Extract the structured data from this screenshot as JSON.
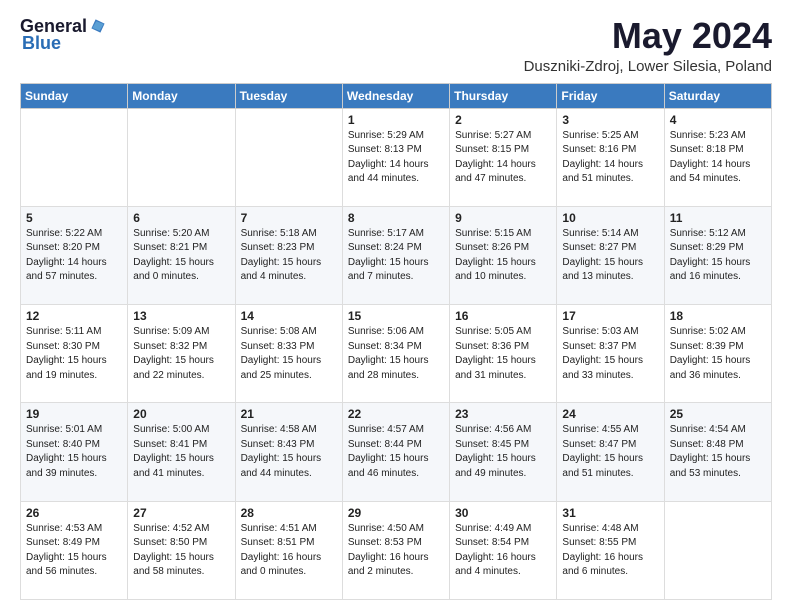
{
  "header": {
    "logo_general": "General",
    "logo_blue": "Blue",
    "month": "May 2024",
    "location": "Duszniki-Zdroj, Lower Silesia, Poland"
  },
  "columns": [
    "Sunday",
    "Monday",
    "Tuesday",
    "Wednesday",
    "Thursday",
    "Friday",
    "Saturday"
  ],
  "weeks": [
    [
      {
        "day": "",
        "info": ""
      },
      {
        "day": "",
        "info": ""
      },
      {
        "day": "",
        "info": ""
      },
      {
        "day": "1",
        "info": "Sunrise: 5:29 AM\nSunset: 8:13 PM\nDaylight: 14 hours\nand 44 minutes."
      },
      {
        "day": "2",
        "info": "Sunrise: 5:27 AM\nSunset: 8:15 PM\nDaylight: 14 hours\nand 47 minutes."
      },
      {
        "day": "3",
        "info": "Sunrise: 5:25 AM\nSunset: 8:16 PM\nDaylight: 14 hours\nand 51 minutes."
      },
      {
        "day": "4",
        "info": "Sunrise: 5:23 AM\nSunset: 8:18 PM\nDaylight: 14 hours\nand 54 minutes."
      }
    ],
    [
      {
        "day": "5",
        "info": "Sunrise: 5:22 AM\nSunset: 8:20 PM\nDaylight: 14 hours\nand 57 minutes."
      },
      {
        "day": "6",
        "info": "Sunrise: 5:20 AM\nSunset: 8:21 PM\nDaylight: 15 hours\nand 0 minutes."
      },
      {
        "day": "7",
        "info": "Sunrise: 5:18 AM\nSunset: 8:23 PM\nDaylight: 15 hours\nand 4 minutes."
      },
      {
        "day": "8",
        "info": "Sunrise: 5:17 AM\nSunset: 8:24 PM\nDaylight: 15 hours\nand 7 minutes."
      },
      {
        "day": "9",
        "info": "Sunrise: 5:15 AM\nSunset: 8:26 PM\nDaylight: 15 hours\nand 10 minutes."
      },
      {
        "day": "10",
        "info": "Sunrise: 5:14 AM\nSunset: 8:27 PM\nDaylight: 15 hours\nand 13 minutes."
      },
      {
        "day": "11",
        "info": "Sunrise: 5:12 AM\nSunset: 8:29 PM\nDaylight: 15 hours\nand 16 minutes."
      }
    ],
    [
      {
        "day": "12",
        "info": "Sunrise: 5:11 AM\nSunset: 8:30 PM\nDaylight: 15 hours\nand 19 minutes."
      },
      {
        "day": "13",
        "info": "Sunrise: 5:09 AM\nSunset: 8:32 PM\nDaylight: 15 hours\nand 22 minutes."
      },
      {
        "day": "14",
        "info": "Sunrise: 5:08 AM\nSunset: 8:33 PM\nDaylight: 15 hours\nand 25 minutes."
      },
      {
        "day": "15",
        "info": "Sunrise: 5:06 AM\nSunset: 8:34 PM\nDaylight: 15 hours\nand 28 minutes."
      },
      {
        "day": "16",
        "info": "Sunrise: 5:05 AM\nSunset: 8:36 PM\nDaylight: 15 hours\nand 31 minutes."
      },
      {
        "day": "17",
        "info": "Sunrise: 5:03 AM\nSunset: 8:37 PM\nDaylight: 15 hours\nand 33 minutes."
      },
      {
        "day": "18",
        "info": "Sunrise: 5:02 AM\nSunset: 8:39 PM\nDaylight: 15 hours\nand 36 minutes."
      }
    ],
    [
      {
        "day": "19",
        "info": "Sunrise: 5:01 AM\nSunset: 8:40 PM\nDaylight: 15 hours\nand 39 minutes."
      },
      {
        "day": "20",
        "info": "Sunrise: 5:00 AM\nSunset: 8:41 PM\nDaylight: 15 hours\nand 41 minutes."
      },
      {
        "day": "21",
        "info": "Sunrise: 4:58 AM\nSunset: 8:43 PM\nDaylight: 15 hours\nand 44 minutes."
      },
      {
        "day": "22",
        "info": "Sunrise: 4:57 AM\nSunset: 8:44 PM\nDaylight: 15 hours\nand 46 minutes."
      },
      {
        "day": "23",
        "info": "Sunrise: 4:56 AM\nSunset: 8:45 PM\nDaylight: 15 hours\nand 49 minutes."
      },
      {
        "day": "24",
        "info": "Sunrise: 4:55 AM\nSunset: 8:47 PM\nDaylight: 15 hours\nand 51 minutes."
      },
      {
        "day": "25",
        "info": "Sunrise: 4:54 AM\nSunset: 8:48 PM\nDaylight: 15 hours\nand 53 minutes."
      }
    ],
    [
      {
        "day": "26",
        "info": "Sunrise: 4:53 AM\nSunset: 8:49 PM\nDaylight: 15 hours\nand 56 minutes."
      },
      {
        "day": "27",
        "info": "Sunrise: 4:52 AM\nSunset: 8:50 PM\nDaylight: 15 hours\nand 58 minutes."
      },
      {
        "day": "28",
        "info": "Sunrise: 4:51 AM\nSunset: 8:51 PM\nDaylight: 16 hours\nand 0 minutes."
      },
      {
        "day": "29",
        "info": "Sunrise: 4:50 AM\nSunset: 8:53 PM\nDaylight: 16 hours\nand 2 minutes."
      },
      {
        "day": "30",
        "info": "Sunrise: 4:49 AM\nSunset: 8:54 PM\nDaylight: 16 hours\nand 4 minutes."
      },
      {
        "day": "31",
        "info": "Sunrise: 4:48 AM\nSunset: 8:55 PM\nDaylight: 16 hours\nand 6 minutes."
      },
      {
        "day": "",
        "info": ""
      }
    ]
  ]
}
